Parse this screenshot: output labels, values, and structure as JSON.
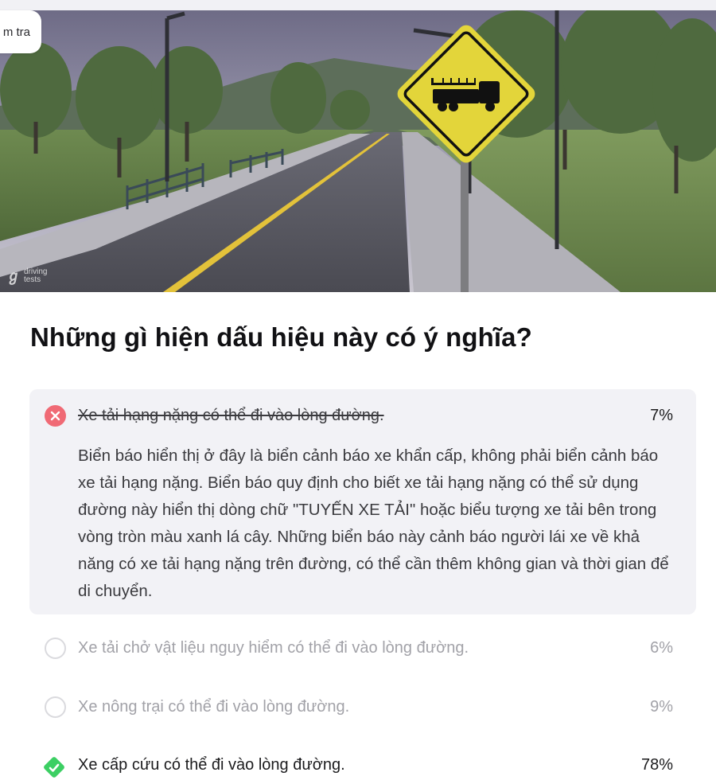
{
  "header": {
    "check_label": "m tra"
  },
  "image": {
    "watermark_line1": "driving",
    "watermark_line2": "tests"
  },
  "question": "Những gì hiện dấu hiệu này có ý nghĩa?",
  "answers": [
    {
      "text": "Xe tải hạng nặng có thể đi vào lòng đường.",
      "percent": "7%",
      "state": "wrong",
      "explanation": "Biển báo hiển thị ở đây là biển cảnh báo xe khẩn cấp, không phải biển cảnh báo xe tải hạng nặng. Biển báo quy định cho biết xe tải hạng nặng có thể sử dụng đường này hiển thị dòng chữ \"TUYẾN XE TẢI\" hoặc biểu tượng xe tải bên trong vòng tròn màu xanh lá cây. Những biển báo này cảnh báo người lái xe về khả năng có xe tải hạng nặng trên đường, có thể cần thêm không gian và thời gian để di chuyển."
    },
    {
      "text": "Xe tải chở vật liệu nguy hiểm có thể đi vào lòng đường.",
      "percent": "6%",
      "state": "unselected"
    },
    {
      "text": "Xe nông trại có thể đi vào lòng đường.",
      "percent": "9%",
      "state": "unselected"
    },
    {
      "text": "Xe cấp cứu có thể đi vào lòng đường.",
      "percent": "78%",
      "state": "correct"
    }
  ],
  "colors": {
    "wrong": "#f06a75",
    "correct": "#3ccf63",
    "card": "#f2f2f6",
    "sign": "#e3d53a"
  },
  "icons": {
    "wrong": "x-circle-icon",
    "unselected": "radio-empty-icon",
    "correct": "check-diamond-icon"
  }
}
